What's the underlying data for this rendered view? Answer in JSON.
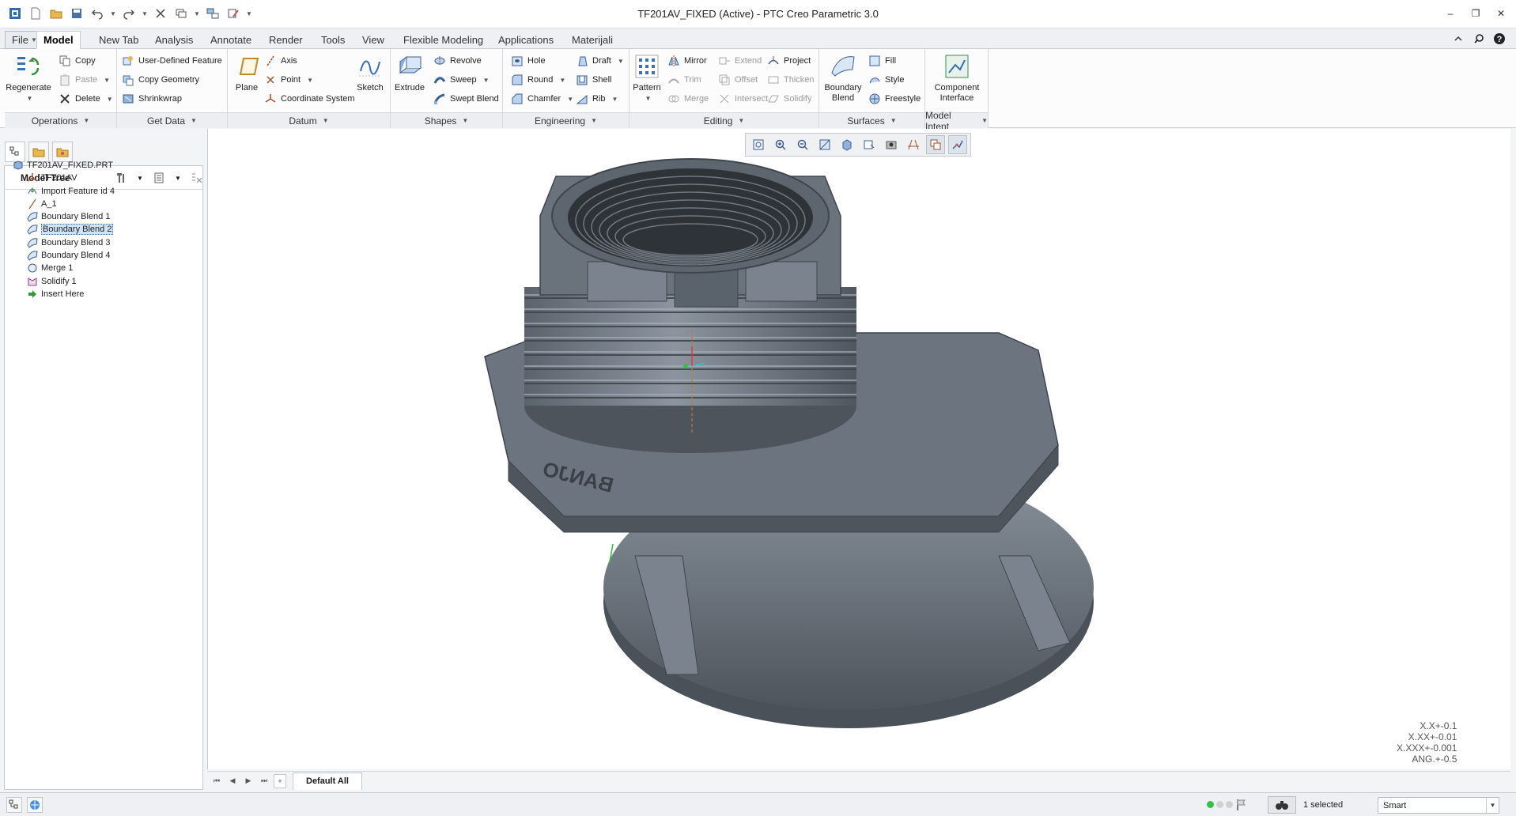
{
  "window": {
    "title": "TF201AV_FIXED (Active) - PTC Creo Parametric 3.0"
  },
  "tabs": [
    {
      "label": "File",
      "file": true
    },
    {
      "label": "Model",
      "active": true
    },
    {
      "label": "New Tab"
    },
    {
      "label": "Analysis"
    },
    {
      "label": "Annotate"
    },
    {
      "label": "Render"
    },
    {
      "label": "Tools"
    },
    {
      "label": "View"
    },
    {
      "label": "Flexible Modeling"
    },
    {
      "label": "Applications"
    },
    {
      "label": "Materijali"
    }
  ],
  "ribbon": {
    "operations": {
      "label": "Operations",
      "regenerate": "Regenerate",
      "copy": "Copy",
      "paste": "Paste",
      "delete": "Delete"
    },
    "get_data": {
      "label": "Get Data",
      "udf": "User-Defined Feature",
      "copy_geometry": "Copy Geometry",
      "shrinkwrap": "Shrinkwrap"
    },
    "datum": {
      "label": "Datum",
      "plane": "Plane",
      "axis": "Axis",
      "point": "Point",
      "csys": "Coordinate System",
      "sketch": "Sketch"
    },
    "shapes": {
      "label": "Shapes",
      "extrude": "Extrude",
      "revolve": "Revolve",
      "sweep": "Sweep",
      "swept_blend": "Swept Blend"
    },
    "engineering": {
      "label": "Engineering",
      "hole": "Hole",
      "round": "Round",
      "chamfer": "Chamfer",
      "draft": "Draft",
      "shell": "Shell",
      "rib": "Rib"
    },
    "editing": {
      "label": "Editing",
      "pattern": "Pattern",
      "mirror": "Mirror",
      "trim": "Trim",
      "merge": "Merge",
      "extend": "Extend",
      "offset": "Offset",
      "intersect": "Intersect",
      "project": "Project",
      "thicken": "Thicken",
      "solidify": "Solidify"
    },
    "surfaces": {
      "label": "Surfaces",
      "boundary_blend": "Boundary\nBlend",
      "fill": "Fill",
      "style": "Style",
      "freestyle": "Freestyle"
    },
    "model_intent": {
      "label": "Model Intent",
      "component_interface": "Component\nInterface"
    }
  },
  "model_tree": {
    "header": "Model Tree",
    "items": [
      {
        "label": "TF201AV_FIXED.PRT",
        "icon": "part-icon"
      },
      {
        "label": "TF201AV",
        "icon": "csys-icon"
      },
      {
        "label": "Import Feature id 4",
        "icon": "import-icon"
      },
      {
        "label": "A_1",
        "icon": "axis-icon"
      },
      {
        "label": "Boundary Blend 1",
        "icon": "boundary-blend-icon"
      },
      {
        "label": "Boundary Blend 2",
        "icon": "boundary-blend-icon",
        "selected": true
      },
      {
        "label": "Boundary Blend 3",
        "icon": "boundary-blend-icon"
      },
      {
        "label": "Boundary Blend 4",
        "icon": "boundary-blend-icon"
      },
      {
        "label": "Merge 1",
        "icon": "merge-icon"
      },
      {
        "label": "Solidify 1",
        "icon": "solidify-icon"
      },
      {
        "label": "Insert Here",
        "icon": "insert-arrow-icon"
      }
    ]
  },
  "graphics": {
    "embossed_text": "BANJO",
    "tolerances": [
      "X.X+-0.1",
      "X.XX+-0.01",
      "X.XXX+-0.001",
      "ANG.+-0.5"
    ]
  },
  "layout_tab": "Default All",
  "status": {
    "selected_text": "1 selected",
    "filter_value": "Smart"
  }
}
